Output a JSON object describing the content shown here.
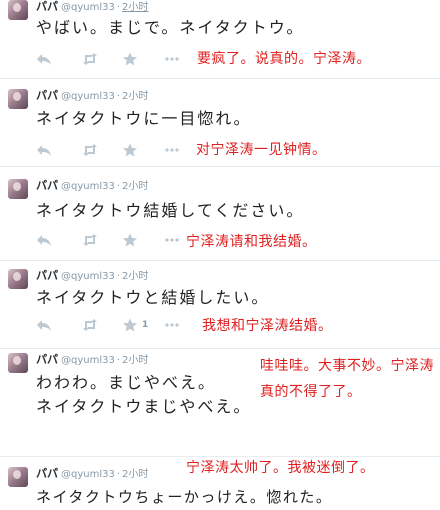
{
  "tweets": [
    {
      "name": "パパ",
      "handle": "@qyuml33",
      "time": "2小时",
      "time_link": true,
      "lines": [
        "やばい。まじで。ネイタクトウ。"
      ],
      "count": "",
      "note": [
        "要疯了。说真的。宁泽涛。"
      ]
    },
    {
      "name": "パパ",
      "handle": "@qyuml33",
      "time": "2小时",
      "time_link": false,
      "lines": [
        "ネイタクトウに一目惚れ。"
      ],
      "count": "",
      "note": [
        "对宁泽涛一见钟情。"
      ]
    },
    {
      "name": "パパ",
      "handle": "@qyuml33",
      "time": "2小时",
      "time_link": false,
      "lines": [
        "ネイタクトウ結婚してください。"
      ],
      "count": "",
      "note": [
        "宁泽涛请和我结婚。"
      ]
    },
    {
      "name": "パパ",
      "handle": "@qyuml33",
      "time": "2小时",
      "time_link": false,
      "lines": [
        "ネイタクトウと結婚したい。"
      ],
      "count": "1",
      "note": [
        "我想和宁泽涛结婚。"
      ]
    },
    {
      "name": "パパ",
      "handle": "@qyuml33",
      "time": "2小时",
      "time_link": false,
      "lines": [
        "わわわ。まじやべえ。",
        "ネイタクトウまじやべえ。"
      ],
      "count": "",
      "note": [
        "哇哇哇。大事不妙。宁泽涛",
        "真的不得了了。"
      ]
    },
    {
      "name": "パパ",
      "handle": "@qyuml33",
      "time": "2小时",
      "time_link": false,
      "lines": [
        "ネイタクトウちょーかっけえ。惚れた。"
      ],
      "count": "",
      "note": [
        "宁泽涛太帅了。我被迷倒了。"
      ]
    }
  ],
  "icons": {
    "reply": "reply-arrow-icon",
    "retweet": "retweet-icon",
    "favorite": "star-icon",
    "more": "more-dots-icon"
  },
  "colors": {
    "annotation": "#e02020",
    "meta": "#8899a6",
    "action": "#bcc8d2"
  }
}
